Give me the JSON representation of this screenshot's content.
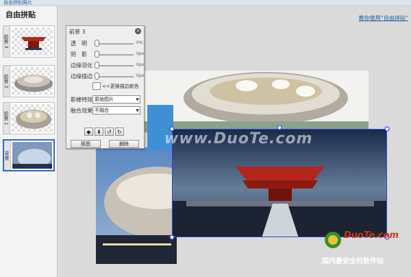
{
  "app": {
    "title": "自由拼贴照片"
  },
  "sidebar": {
    "title": "自由拼贴",
    "layers": [
      {
        "label": "前景 3"
      },
      {
        "label": "前景 2"
      },
      {
        "label": "前景 1"
      },
      {
        "label": "背景"
      }
    ]
  },
  "header": {
    "help_link": "教你使用“自由拼贴”"
  },
  "panel": {
    "title": "前景 3",
    "close_icon": "close-icon",
    "transparency": {
      "label": "透　明",
      "value": "0%"
    },
    "shadow": {
      "label": "阴　影",
      "value": "0px"
    },
    "feather": {
      "label": "边缘羽化",
      "value": "0px"
    },
    "border": {
      "label": "边缘描边",
      "value": "0px"
    },
    "change_color_label": "<<更换描边颜色",
    "effect": {
      "label": "影楼特效",
      "value": "原始图片"
    },
    "blend": {
      "label": "融合效果",
      "value": "不融合"
    },
    "tools": [
      "flip-horizontal-icon",
      "flip-vertical-icon",
      "rotate-left-icon",
      "rotate-right-icon"
    ],
    "cutout_button": "抠图",
    "delete_button": "删除"
  },
  "watermark": {
    "center_text": "www.DuoTe.com",
    "brand_text": "DuoTe.com",
    "tagline": "国内最安全的软件站"
  },
  "colors": {
    "selection": "#2c44d8",
    "link": "#1f5fa8",
    "active_layer": "#2c66c8"
  }
}
